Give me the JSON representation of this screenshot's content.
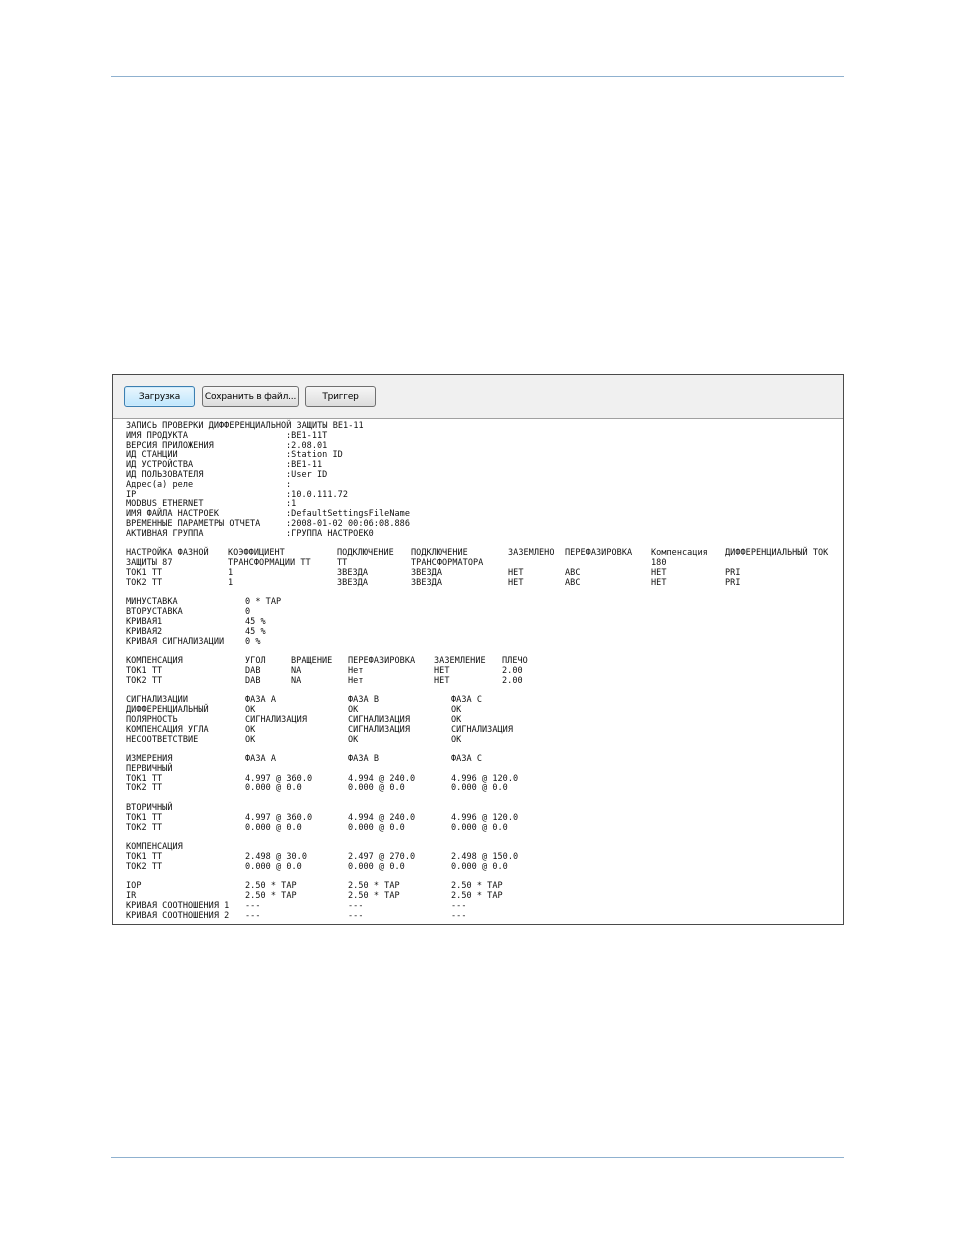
{
  "toolbar": {
    "load_label": "Загрузка",
    "save_label": "Сохранить в файл...",
    "trigger_label": "Триггер"
  },
  "header": {
    "title": "ЗАПИСЬ ПРОВЕРКИ ДИФФЕРЕНЦИАЛЬНОЙ ЗАЩИТЫ BE1-11",
    "fields": [
      {
        "label": "ИМЯ ПРОДУКТА",
        "value": ":BE1-11T"
      },
      {
        "label": "ВЕРСИЯ ПРИЛОЖЕНИЯ",
        "value": ":2.08.01"
      },
      {
        "label": "ИД СТАНЦИИ",
        "value": ":Station ID"
      },
      {
        "label": "ИД УСТРОЙСТВА",
        "value": ":BE1-11"
      },
      {
        "label": "ИД ПОЛЬЗОВАТЕЛЯ",
        "value": ":User ID"
      },
      {
        "label": "Адрес(а) реле",
        "value": ":"
      },
      {
        "label": "IP",
        "value": ":10.0.111.72"
      },
      {
        "label": "MODBUS ETHERNET",
        "value": ":1"
      },
      {
        "label": "ИМЯ ФАЙЛА НАСТРОЕК",
        "value": ":DefaultSettingsFileName"
      },
      {
        "label": "ВРЕМЕННЫЕ ПАРАМЕТРЫ ОТЧЕТА",
        "value": ":2008-01-02 00:06:08.886"
      },
      {
        "label": "АКТИВНАЯ ГРУППА",
        "value": ":ГРУППА НАСТРОЕК0"
      }
    ]
  },
  "settings": {
    "header1": [
      "НАСТРОЙКА ФАЗНОЙ",
      "КОЭФФИЦИЕНТ",
      "ПОДКЛЮЧЕНИЕ",
      "ПОДКЛЮЧЕНИЕ",
      "ЗАЗЕМЛЕНО",
      "ПЕРЕФАЗИРОВКА",
      "Компенсация",
      "ДИФФЕРЕНЦИАЛЬНЫЙ ТОК"
    ],
    "header2": [
      "ЗАЩИТЫ 87",
      "ТРАНСФОРМАЦИИ ТТ",
      "ТТ",
      "ТРАНСФОРМАТОРА",
      "",
      "",
      "180",
      ""
    ],
    "rows": [
      [
        "ТОК1 ТТ",
        "1",
        "ЗВЕЗДА",
        "ЗВЕЗДА",
        "НЕТ",
        "ABC",
        "НЕТ",
        "PRI"
      ],
      [
        "ТОК2 ТТ",
        "1",
        "ЗВЕЗДА",
        "ЗВЕЗДА",
        "НЕТ",
        "ABC",
        "НЕТ",
        "PRI"
      ]
    ]
  },
  "pickups": [
    [
      "МИНУСТАВКА",
      "0 * TAP"
    ],
    [
      "ВТОРУСТАВКА",
      "0"
    ],
    [
      "КРИВАЯ1",
      "45 %"
    ],
    [
      "КРИВАЯ2",
      "45 %"
    ],
    [
      "КРИВАЯ СИГНАЛИЗАЦИИ",
      "0 %"
    ]
  ],
  "compensation": {
    "header": [
      "КОМПЕНСАЦИЯ",
      "УГОЛ",
      "ВРАЩЕНИЕ",
      "ПЕРЕФАЗИРОВКА",
      "ЗАЗЕМЛЕНИЕ",
      "ПЛЕЧО"
    ],
    "rows": [
      [
        "ТОК1 ТТ",
        "DAB",
        "NA",
        "Нет",
        "НЕТ",
        "2.00"
      ],
      [
        "ТОК2 ТТ",
        "DAB",
        "NA",
        "Нет",
        "НЕТ",
        "2.00"
      ]
    ]
  },
  "alarms": {
    "header": [
      "СИГНАЛИЗАЦИИ",
      "ФАЗА А",
      "ФАЗА В",
      "ФАЗА С"
    ],
    "rows": [
      [
        "ДИФФЕРЕНЦИАЛЬНЫЙ",
        "OK",
        "OK",
        "OK"
      ],
      [
        "ПОЛЯРНОСТЬ",
        "СИГНАЛИЗАЦИЯ",
        "СИГНАЛИЗАЦИЯ",
        "OK"
      ],
      [
        "КОМПЕНСАЦИЯ УГЛА",
        "OK",
        "СИГНАЛИЗАЦИЯ",
        "СИГНАЛИЗАЦИЯ"
      ],
      [
        "НЕСООТВЕТСТВИЕ",
        "OK",
        "OK",
        "OK"
      ]
    ]
  },
  "measurements": {
    "header": [
      "ИЗМЕРЕНИЯ",
      "ФАЗА А",
      "ФАЗА В",
      "ФАЗА С"
    ],
    "primary_label": "ПЕРВИЧНЫЙ",
    "primary": [
      [
        "ТОК1 ТТ",
        "4.997 @ 360.0",
        "4.994 @ 240.0",
        "4.996 @ 120.0"
      ],
      [
        "ТОК2 ТТ",
        "0.000 @ 0.0",
        "0.000 @ 0.0",
        "0.000 @ 0.0"
      ]
    ],
    "secondary_label": "ВТОРИЧНЫЙ",
    "secondary": [
      [
        "ТОК1 ТТ",
        "4.997 @ 360.0",
        "4.994 @ 240.0",
        "4.996 @ 120.0"
      ],
      [
        "ТОК2 ТТ",
        "0.000 @ 0.0",
        "0.000 @ 0.0",
        "0.000 @ 0.0"
      ]
    ],
    "compensated_label": "КОМПЕНСАЦИЯ",
    "compensated": [
      [
        "ТОК1 ТТ",
        "2.498 @ 30.0",
        "2.497 @ 270.0",
        "2.498 @ 150.0"
      ],
      [
        "ТОК2 ТТ",
        "0.000 @ 0.0",
        "0.000 @ 0.0",
        "0.000 @ 0.0"
      ]
    ]
  },
  "operate": [
    [
      "IOP",
      "2.50 * TAP",
      "2.50 * TAP",
      "2.50 * TAP"
    ],
    [
      "IR",
      "2.50 * TAP",
      "2.50 * TAP",
      "2.50 * TAP"
    ],
    [
      "КРИВАЯ СООТНОШЕНИЯ 1",
      "---",
      "---",
      "---"
    ],
    [
      "КРИВАЯ СООТНОШЕНИЯ 2",
      "---",
      "---",
      "---"
    ]
  ]
}
